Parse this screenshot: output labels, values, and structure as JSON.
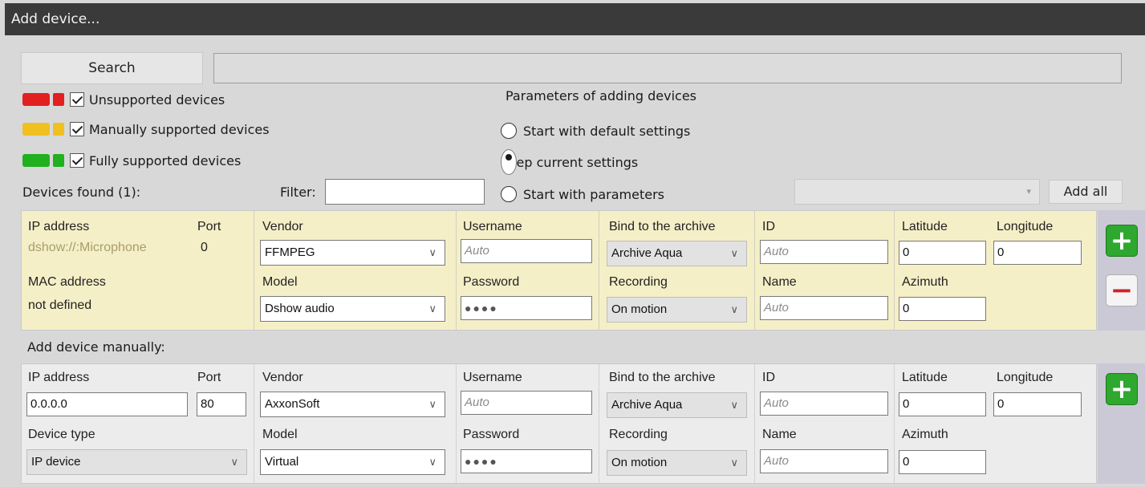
{
  "window": {
    "title": "Add device..."
  },
  "search": {
    "button_label": "Search",
    "field_value": ""
  },
  "legend": [
    {
      "label": "Unsupported devices",
      "color": "#e32020",
      "checked": true
    },
    {
      "label": "Manually supported devices",
      "color": "#f0c020",
      "checked": true
    },
    {
      "label": "Fully supported devices",
      "color": "#20b020",
      "checked": true
    }
  ],
  "params": {
    "title": "Parameters of adding devices",
    "options": [
      {
        "label": "Start with default settings",
        "selected": false
      },
      {
        "label": "Keep current settings",
        "selected": true
      },
      {
        "label": "Start with parameters",
        "selected": false
      }
    ],
    "combo_value": ""
  },
  "found": {
    "title": "Devices found (1):",
    "filter_label": "Filter:",
    "filter_value": "",
    "add_all_label": "Add all",
    "device": {
      "ip_label": "IP address",
      "ip_value": "dshow://:Microphone",
      "port_label": "Port",
      "port_value": "0",
      "mac_label": "MAC address",
      "mac_value": "not defined",
      "vendor_label": "Vendor",
      "vendor_value": "FFMPEG",
      "model_label": "Model",
      "model_value": "Dshow audio",
      "username_label": "Username",
      "username_placeholder": "Auto",
      "password_label": "Password",
      "password_value": "●●●●",
      "archive_label": "Bind to the archive",
      "archive_value": "Archive Aqua",
      "recording_label": "Recording",
      "recording_value": "On motion",
      "id_label": "ID",
      "id_placeholder": "Auto",
      "name_label": "Name",
      "name_placeholder": "Auto",
      "latitude_label": "Latitude",
      "latitude_value": "0",
      "longitude_label": "Longitude",
      "longitude_value": "0",
      "azimuth_label": "Azimuth",
      "azimuth_value": "0"
    }
  },
  "manual": {
    "title": "Add device manually:",
    "ip_label": "IP address",
    "ip_value": "0.0.0.0",
    "port_label": "Port",
    "port_value": "80",
    "type_label": "Device type",
    "type_value": "IP device",
    "vendor_label": "Vendor",
    "vendor_value": "AxxonSoft",
    "model_label": "Model",
    "model_value": "Virtual",
    "username_label": "Username",
    "username_placeholder": "Auto",
    "password_label": "Password",
    "password_value": "●●●●",
    "archive_label": "Bind to the archive",
    "archive_value": "Archive Aqua",
    "recording_label": "Recording",
    "recording_value": "On motion",
    "id_label": "ID",
    "id_placeholder": "Auto",
    "name_label": "Name",
    "name_placeholder": "Auto",
    "latitude_label": "Latitude",
    "latitude_value": "0",
    "longitude_label": "Longitude",
    "longitude_value": "0",
    "azimuth_label": "Azimuth",
    "azimuth_value": "0"
  },
  "icons": {
    "add": "+",
    "remove": "−",
    "chevron": "∨",
    "combo_arrow": "▾"
  }
}
